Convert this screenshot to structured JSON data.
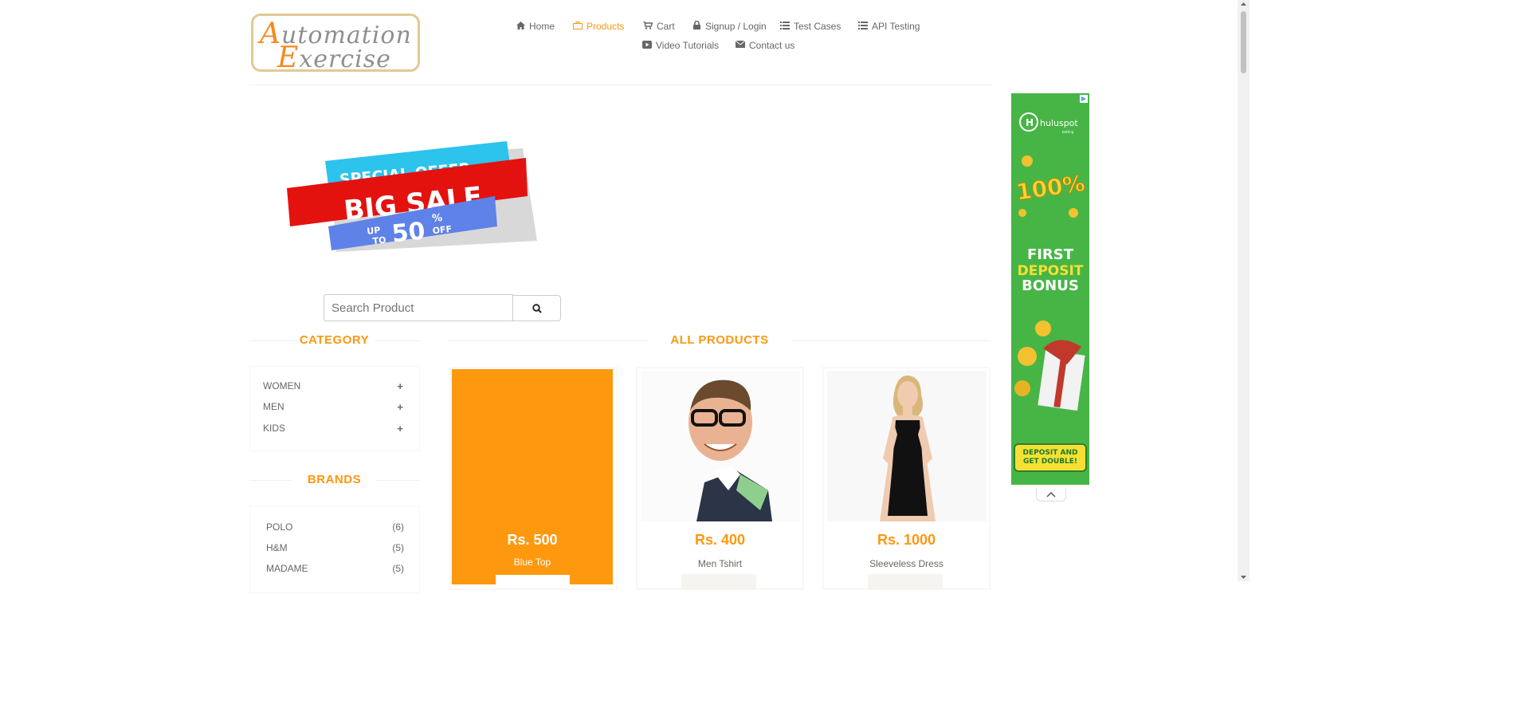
{
  "logo": {
    "line1_cap": "A",
    "line1_rest": "utomation",
    "line2_cap": "E",
    "line2_rest": "xercise"
  },
  "nav": {
    "home": "Home",
    "products": "Products",
    "cart": "Cart",
    "signup": "Signup / Login",
    "test_cases": "Test Cases",
    "api_testing": "API Testing",
    "video_tutorials": "Video Tutorials",
    "contact": "Contact us"
  },
  "banner": {
    "line1": "SPECIAL OFFER",
    "line2": "BIG SALE",
    "up": "UP",
    "to": "TO",
    "value": "50",
    "percent": "%",
    "off": "OFF"
  },
  "search": {
    "placeholder": "Search Product"
  },
  "sidebar": {
    "category_title": "CATEGORY",
    "categories": [
      {
        "label": "WOMEN",
        "icon": "+"
      },
      {
        "label": "MEN",
        "icon": "+"
      },
      {
        "label": "KIDS",
        "icon": "+"
      }
    ],
    "brands_title": "BRANDS",
    "brands": [
      {
        "label": "POLO",
        "count": "(6)"
      },
      {
        "label": "H&M",
        "count": "(5)"
      },
      {
        "label": "MADAME",
        "count": "(5)"
      }
    ]
  },
  "main": {
    "title": "ALL PRODUCTS",
    "products": [
      {
        "price": "Rs. 500",
        "name": "Blue Top"
      },
      {
        "price": "Rs. 400",
        "name": "Men Tshirt"
      },
      {
        "price": "Rs. 1000",
        "name": "Sleeveless Dress"
      }
    ]
  },
  "ad": {
    "brand": "huluspot",
    "brand_sub": "betting",
    "percent": "100%",
    "line1": "FIRST",
    "line2": "DEPOSIT",
    "line3": "BONUS",
    "cta": "DEPOSIT AND GET DOUBLE!"
  },
  "colors": {
    "accent": "#FE980F",
    "text": "#696763",
    "ad_green": "#47B546"
  }
}
